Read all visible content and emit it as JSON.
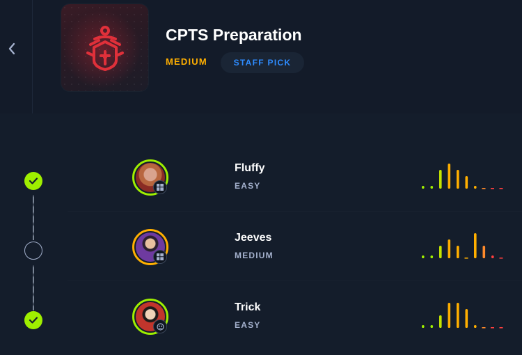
{
  "header": {
    "title": "CPTS Preparation",
    "difficulty": "MEDIUM",
    "badge": "STAFF PICK",
    "cover_icon": "shield-key-logo-icon",
    "colors": {
      "difficulty": "#ffaf00",
      "badge_text": "#2e8cff",
      "cover_logo": "#e0303a"
    }
  },
  "machines": [
    {
      "name": "Fluffy",
      "difficulty": "EASY",
      "completed": true,
      "os": "windows",
      "ring_color": "#9fef00",
      "difficulty_rating": [
        1,
        1,
        3,
        4,
        3,
        2,
        1,
        0,
        0,
        0
      ]
    },
    {
      "name": "Jeeves",
      "difficulty": "MEDIUM",
      "completed": false,
      "os": "windows",
      "ring_color": "#ffaf00",
      "difficulty_rating": [
        1,
        1,
        2,
        3,
        2,
        0,
        4,
        2,
        1,
        0
      ]
    },
    {
      "name": "Trick",
      "difficulty": "EASY",
      "completed": true,
      "os": "linux",
      "ring_color": "#9fef00",
      "difficulty_rating": [
        1,
        1,
        2,
        4,
        4,
        3,
        1,
        0,
        0,
        0
      ]
    }
  ],
  "colors": {
    "complete": "#9fef00",
    "bar_scale": [
      "#9fef00",
      "#9fef00",
      "#c4e500",
      "#ffaf00",
      "#ffaf00",
      "#ffaf00",
      "#ffaf00",
      "#ff8a2b",
      "#ff3e3e",
      "#ff3e3e"
    ]
  }
}
